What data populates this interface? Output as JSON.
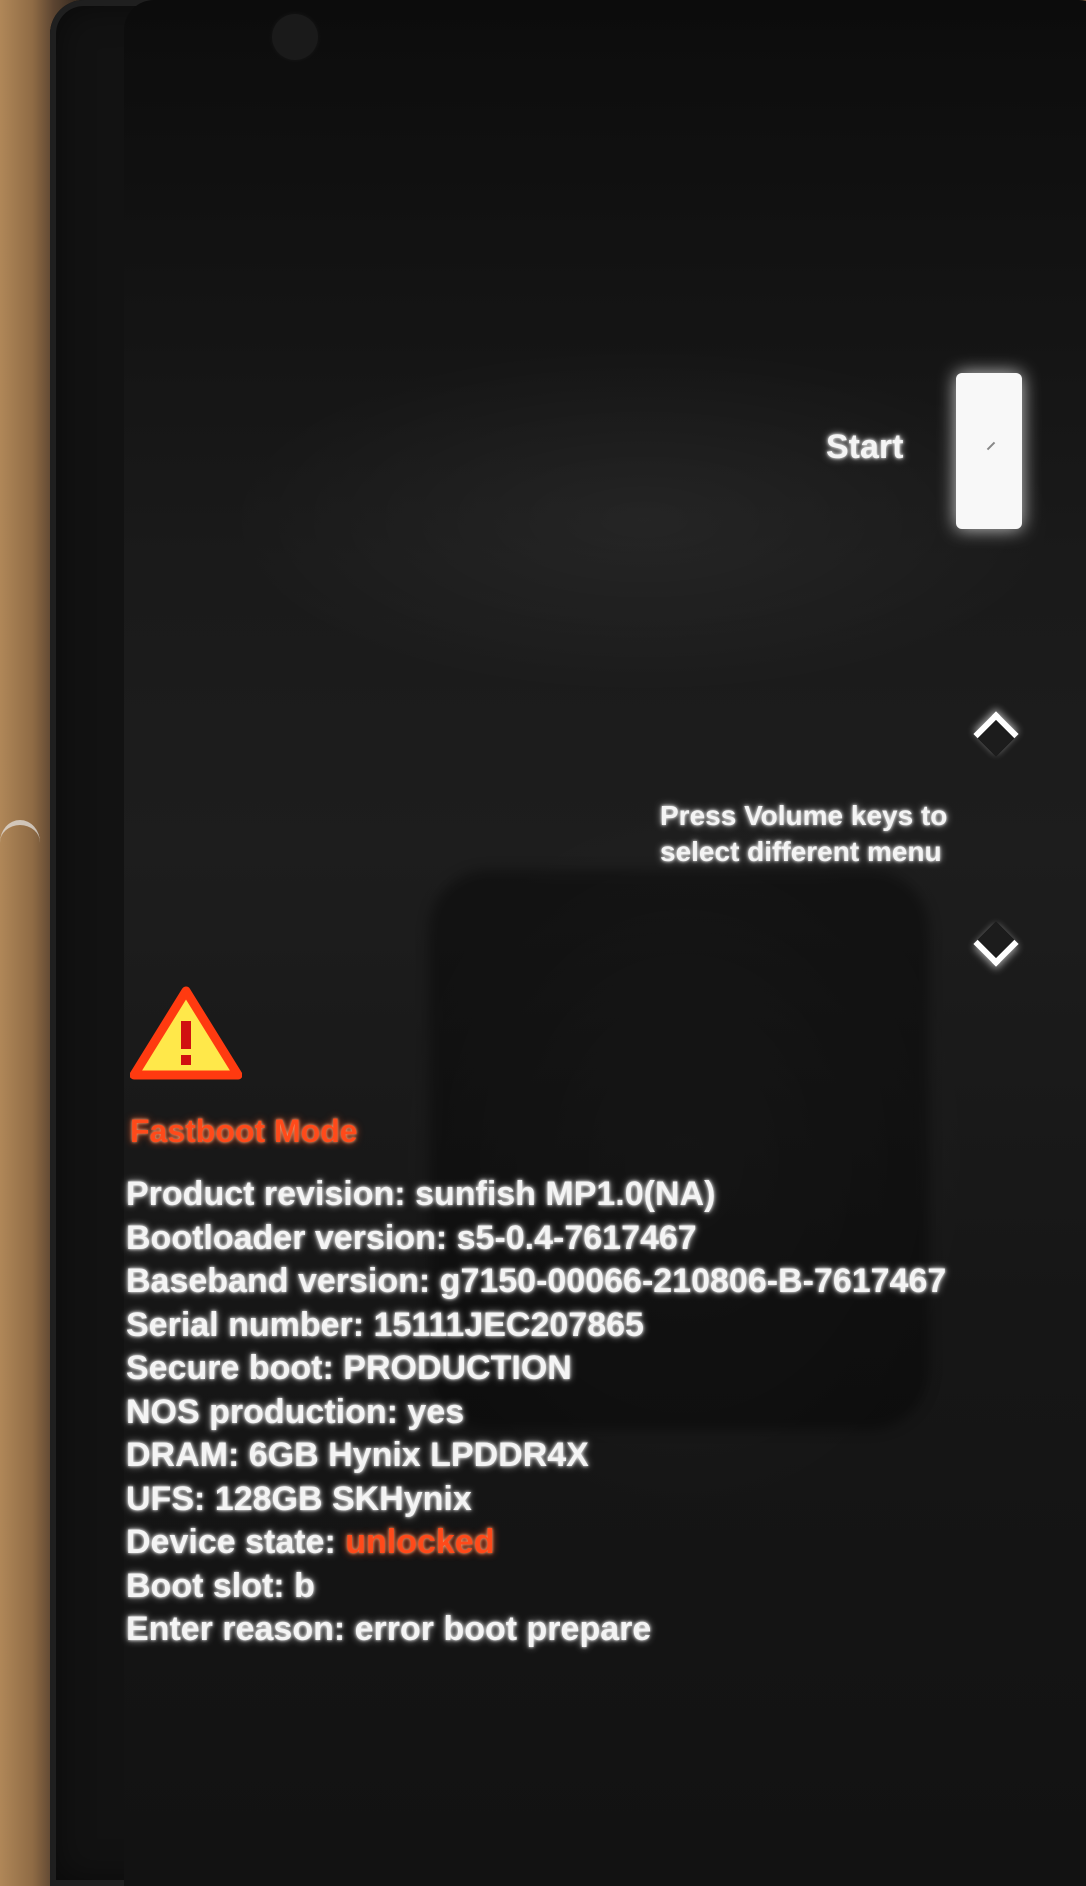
{
  "menu": {
    "selected_label": "Start",
    "hint_line1": "Press Volume keys to",
    "hint_line2": "select different menu"
  },
  "mode": {
    "title": "Fastboot Mode"
  },
  "info": [
    {
      "label": "Product revision:",
      "value": "sunfish MP1.0(NA)"
    },
    {
      "label": "Bootloader version:",
      "value": "s5-0.4-7617467"
    },
    {
      "label": "Baseband version:",
      "value": "g7150-00066-210806-B-7617467"
    },
    {
      "label": "Serial number:",
      "value": "15111JEC207865"
    },
    {
      "label": "Secure boot:",
      "value": "PRODUCTION"
    },
    {
      "label": "NOS production:",
      "value": "yes"
    },
    {
      "label": "DRAM:",
      "value": "6GB Hynix LPDDR4X"
    },
    {
      "label": "UFS:",
      "value": "128GB SKHynix"
    },
    {
      "label": "Device state:",
      "value": "unlocked"
    },
    {
      "label": "Boot slot:",
      "value": "b"
    },
    {
      "label": "Enter reason:",
      "value": "error boot prepare"
    }
  ],
  "icons": {
    "warning": "warning-triangle-icon",
    "up": "chevron-up-icon",
    "down": "chevron-down-icon"
  },
  "colors": {
    "warning_accent": "#ff4a1a",
    "warning_fill": "#ffe84a",
    "text": "#f4f4f4"
  }
}
